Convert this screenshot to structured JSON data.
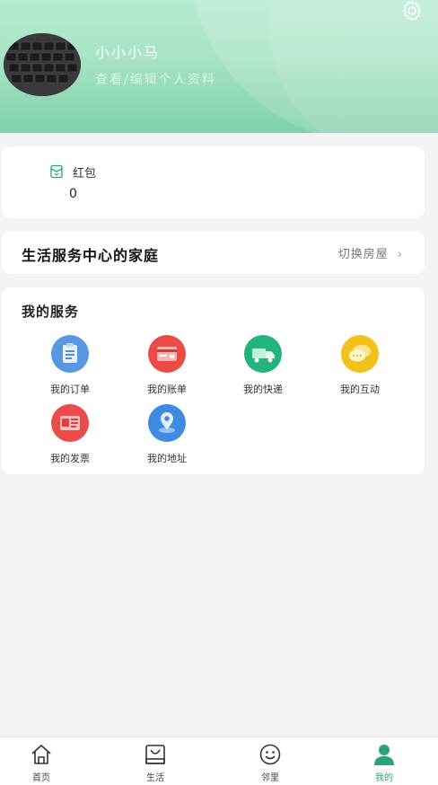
{
  "profile": {
    "username": "小小小马",
    "edit_link": "查看/编辑个人资料"
  },
  "wallet": {
    "red_packet_label": "红包",
    "red_packet_value": "0"
  },
  "home": {
    "title": "生活服务中心的家庭",
    "switch_label": "切换房屋"
  },
  "services": {
    "title": "我的服务",
    "items": [
      {
        "label": "我的订单",
        "icon": "order-icon",
        "color": "#4c8fe0"
      },
      {
        "label": "我的账单",
        "icon": "bill-icon",
        "color": "#ea4b47"
      },
      {
        "label": "我的快递",
        "icon": "delivery-icon",
        "color": "#23b37c"
      },
      {
        "label": "我的互动",
        "icon": "chat-icon",
        "color": "#f2c21a"
      },
      {
        "label": "我的发票",
        "icon": "invoice-icon",
        "color": "#eb4b4b"
      },
      {
        "label": "我的地址",
        "icon": "location-icon",
        "color": "#3f8be0"
      }
    ]
  },
  "tabbar": {
    "tabs": [
      {
        "label": "首页",
        "icon": "home-icon"
      },
      {
        "label": "生活",
        "icon": "shopping-bag-icon"
      },
      {
        "label": "邻里",
        "icon": "smile-icon"
      },
      {
        "label": "我的",
        "icon": "user-icon",
        "active": true
      }
    ]
  },
  "colors": {
    "header_gradient_top": "#b6ead2",
    "header_gradient_bottom": "#7fd0a8",
    "accent": "#2aa37a"
  }
}
